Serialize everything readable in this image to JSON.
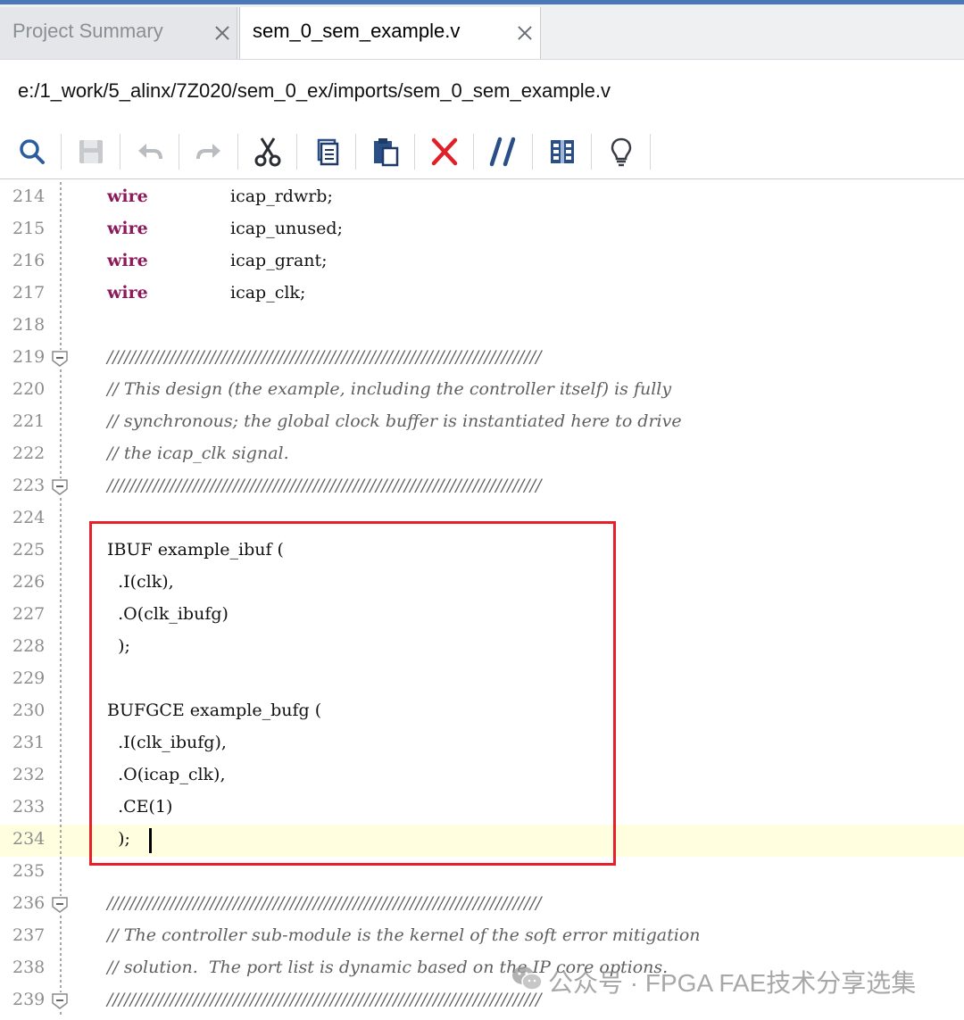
{
  "tabs": [
    {
      "label": "Project Summary",
      "active": false
    },
    {
      "label": "sem_0_sem_example.v",
      "active": true
    }
  ],
  "file_path": "e:/1_work/5_alinx/7Z020/sem_0_ex/imports/sem_0_sem_example.v",
  "toolbar": [
    "search-icon",
    "save-icon",
    "undo-icon",
    "redo-icon",
    "cut-icon",
    "copy-icon",
    "paste-icon",
    "delete-icon",
    "comment-icon",
    "columns-icon",
    "bulb-icon"
  ],
  "editor": {
    "lines": [
      {
        "num": "214",
        "kw": "wire",
        "text": "icap_rdwrb;"
      },
      {
        "num": "215",
        "kw": "wire",
        "text": "icap_unused;"
      },
      {
        "num": "216",
        "kw": "wire",
        "text": "icap_grant;"
      },
      {
        "num": "217",
        "kw": "wire",
        "text": "icap_clk;"
      },
      {
        "num": "218",
        "text": ""
      },
      {
        "num": "219",
        "fold": true,
        "comment": "////////////////////////////////////////////////////////////////////////////"
      },
      {
        "num": "220",
        "comment": "// This design (the example, including the controller itself) is fully"
      },
      {
        "num": "221",
        "comment": "// synchronous; the global clock buffer is instantiated here to drive"
      },
      {
        "num": "222",
        "comment": "// the icap_clk signal."
      },
      {
        "num": "223",
        "fold": true,
        "comment": "////////////////////////////////////////////////////////////////////////////"
      },
      {
        "num": "224",
        "text": ""
      },
      {
        "num": "225",
        "text": "IBUF example_ibuf ("
      },
      {
        "num": "226",
        "text": "  .I(clk),"
      },
      {
        "num": "227",
        "text": "  .O(clk_ibufg)"
      },
      {
        "num": "228",
        "text": "  );"
      },
      {
        "num": "229",
        "text": ""
      },
      {
        "num": "230",
        "text": "BUFGCE example_bufg ("
      },
      {
        "num": "231",
        "text": "  .I(clk_ibufg),"
      },
      {
        "num": "232",
        "text": "  .O(icap_clk),"
      },
      {
        "num": "233",
        "text": "  .CE(1)"
      },
      {
        "num": "234",
        "text": "  );",
        "current": true
      },
      {
        "num": "235",
        "text": ""
      },
      {
        "num": "236",
        "fold": true,
        "comment": "////////////////////////////////////////////////////////////////////////////"
      },
      {
        "num": "237",
        "comment": "// The controller sub-module is the kernel of the soft error mitigation"
      },
      {
        "num": "238",
        "comment": "// solution.  The port list is dynamic based on the IP core options."
      },
      {
        "num": "239",
        "fold": true,
        "comment": "////////////////////////////////////////////////////////////////////////////"
      }
    ]
  },
  "watermark": {
    "text": "公众号 · FPGA FAE技术分享选集"
  },
  "colors": {
    "keyword": "#8b1a5a",
    "comment": "#5f5f5f",
    "highlight_box": "#e8202a",
    "current_line": "#ffffe0",
    "tab_accent": "#4a78b8"
  }
}
